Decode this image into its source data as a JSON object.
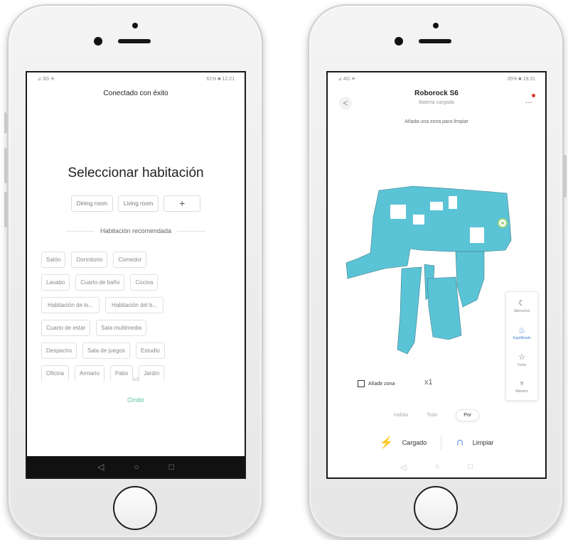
{
  "left_phone": {
    "status": {
      "left": "⊿ 3G ≋",
      "right": "61% ■ 12:21"
    },
    "header_title": "Conectado con éxito",
    "main_title": "Seleccionar habitación",
    "rooms": [
      "Dining room",
      "Living room"
    ],
    "add_symbol": "+",
    "recommended_title": "Habitación recomendada",
    "suggestions": [
      [
        "Salón",
        "Dormitorio",
        "Comedor"
      ],
      [
        "Lavabo",
        "Cuarto de baño",
        "Cocina"
      ],
      [
        "Habitación de lo...",
        "Habitación del b..."
      ],
      [
        "Cuarto de estar",
        "Sala multimedia"
      ],
      [
        "Despacho",
        "Sala de juegos",
        "Estudio"
      ],
      [
        "Oficina",
        "Armario",
        "Patio",
        "Jardín"
      ]
    ],
    "pager": "1/2",
    "omit_label": "Omitir",
    "nav": {
      "back": "◁",
      "home": "○",
      "recent": "□"
    }
  },
  "right_phone": {
    "status": {
      "left": "⊿ 4G ≋",
      "right": "35% ■ 19:31"
    },
    "back_symbol": "<",
    "device_name": "Roborock S6",
    "device_status": "Batería cargada",
    "more_symbol": "...",
    "hint": "Añada una zona para limpiar",
    "modes": [
      {
        "icon": "moon-icon",
        "label": "Silencioso",
        "active": false
      },
      {
        "icon": "balance-icon",
        "label": "Equilibrado",
        "active": true
      },
      {
        "icon": "star-icon",
        "label": "Turbo",
        "active": false
      },
      {
        "icon": "fan-icon",
        "label": "Máximo",
        "active": false
      }
    ],
    "add_zone_label": "Añadir zona",
    "times_label": "x1",
    "tabs": [
      {
        "label": "Habita",
        "active": false
      },
      {
        "label": "Todo",
        "active": false
      },
      {
        "label": "Por",
        "active": true
      }
    ],
    "actions": {
      "charge": "Cargado",
      "clean": "Limpiar"
    },
    "nav": {
      "back": "◁",
      "home": "○",
      "recent": "□"
    }
  },
  "colors": {
    "map": "#5bc3d6",
    "accent": "#2d6bcf",
    "omit": "#5fc6a4",
    "dot": "#e03a2f"
  }
}
